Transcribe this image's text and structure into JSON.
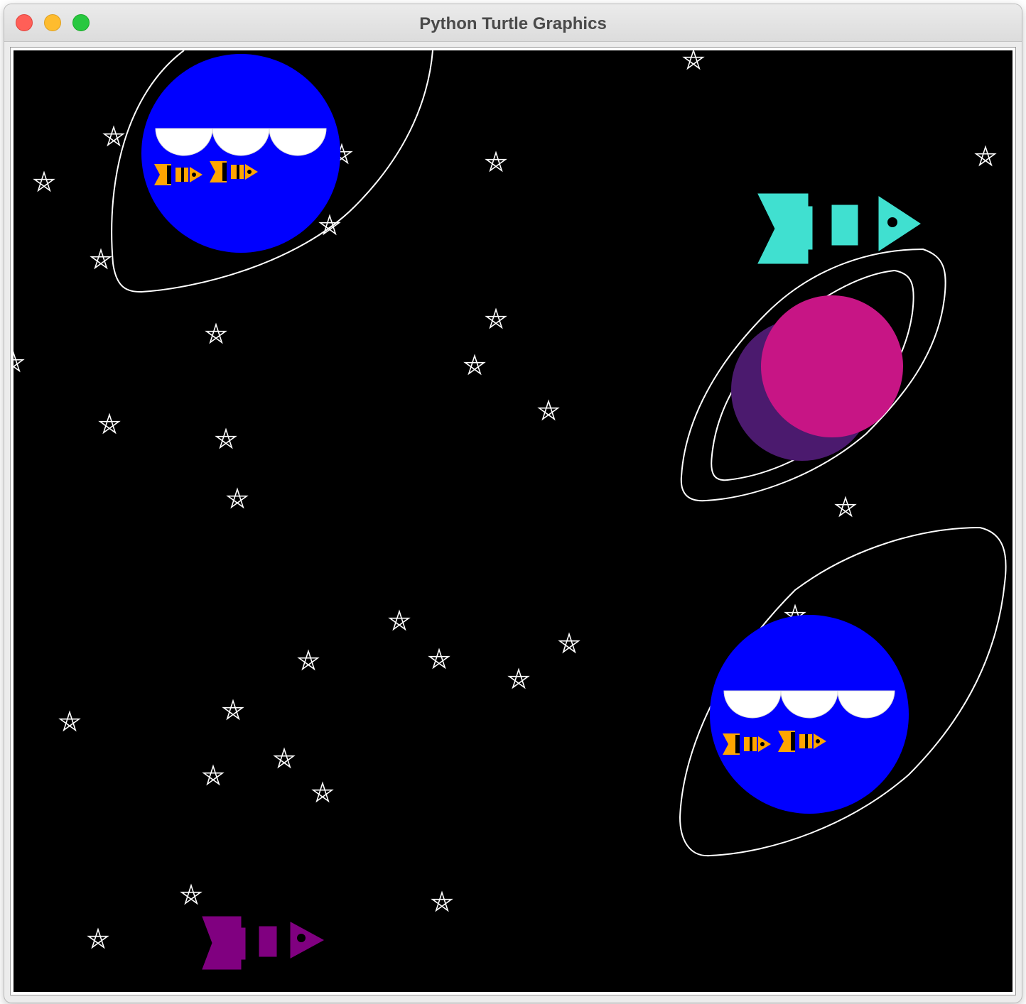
{
  "window": {
    "title": "Python Turtle Graphics"
  },
  "icons": {
    "close": "close-button",
    "minimize": "minimize-button",
    "zoom": "zoom-button"
  },
  "colors": {
    "canvas_background": "#000000",
    "stars": "#ffffff",
    "blue_planet": "#0000ff",
    "magenta_planet": "#c71585",
    "magenta_planet_shadow": "#4b1a6e",
    "orange_rocket": "#ffa500",
    "turquoise_rocket": "#40e0d0",
    "purple_rocket": "#800080"
  }
}
